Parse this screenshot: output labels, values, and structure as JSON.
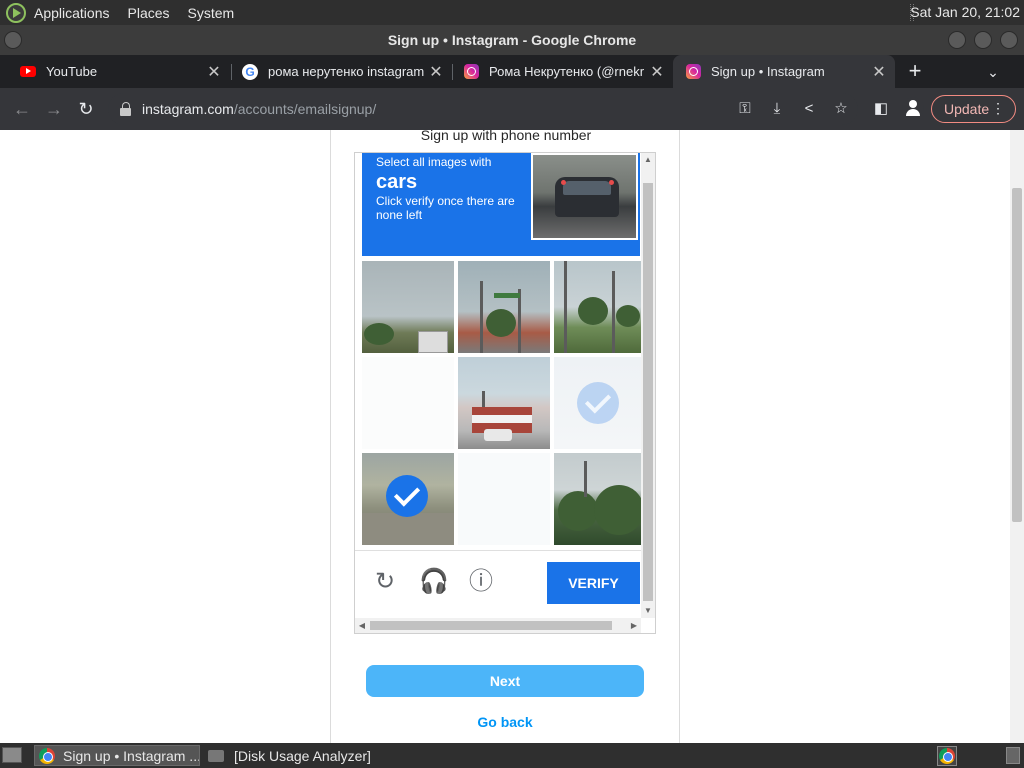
{
  "top_panel": {
    "menus": [
      "Applications",
      "Places",
      "System"
    ],
    "clock": "Sat Jan 20, 21:02"
  },
  "window": {
    "title": "Sign up • Instagram - Google Chrome"
  },
  "tabs": [
    {
      "title": "YouTube",
      "icon": "youtube-icon"
    },
    {
      "title": "рома нерутенко instagram",
      "icon": "google-icon"
    },
    {
      "title": "Рома Некрутенко (@rnekr",
      "icon": "instagram-icon"
    },
    {
      "title": "Sign up • Instagram",
      "icon": "instagram-icon",
      "active": true
    }
  ],
  "toolbar": {
    "url_host": "instagram.com",
    "url_path": "/accounts/emailsignup/",
    "update_label": "Update"
  },
  "page": {
    "signup_phone": "Sign up with phone number",
    "next_label": "Next",
    "go_back_label": "Go back"
  },
  "captcha": {
    "instruction_line1": "Select all images with",
    "target": "cars",
    "instruction_line3": "Click verify once there are none left",
    "verify_label": "VERIFY",
    "selected_tiles": [
      5,
      6
    ],
    "accent_color": "#1a73e8"
  },
  "taskbar": {
    "tasks": [
      "Sign up • Instagram ...",
      "[Disk Usage Analyzer]"
    ]
  },
  "colors": {
    "next_button": "#4cb5f9",
    "link": "#0095f6",
    "update_border": "#f28b82"
  }
}
